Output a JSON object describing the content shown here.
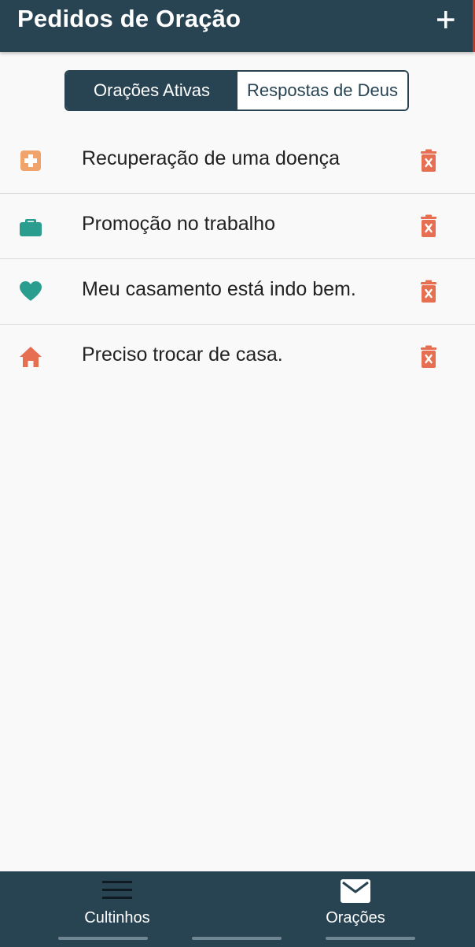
{
  "header": {
    "title": "Pedidos de Oração",
    "add_icon": "plus-icon"
  },
  "tabs": [
    {
      "label": "Orações Ativas",
      "active": true
    },
    {
      "label": "Respostas de Deus",
      "active": false
    }
  ],
  "prayers": [
    {
      "text": "Recuperação de uma doença",
      "icon": "medical-cross-icon",
      "color": "#f0a36b"
    },
    {
      "text": "Promoção no trabalho",
      "icon": "briefcase-icon",
      "color": "#2a9d8f"
    },
    {
      "text": "Meu casamento está indo bem.",
      "icon": "heart-icon",
      "color": "#2a9d8f"
    },
    {
      "text": "Preciso trocar de casa.",
      "icon": "home-icon",
      "color": "#e76f51"
    }
  ],
  "bottom_nav": [
    {
      "label": "Cultinhos",
      "icon": "menu-icon"
    },
    {
      "label": "Orações",
      "icon": "envelope-icon"
    }
  ],
  "colors": {
    "primary": "#284453",
    "delete": "#e76f51",
    "background": "#f9f9f9"
  }
}
